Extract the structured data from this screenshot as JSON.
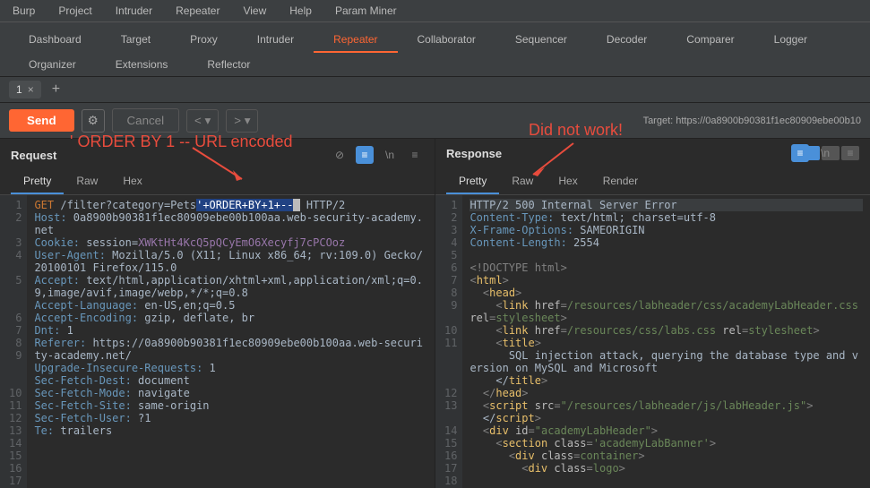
{
  "menu": [
    "Burp",
    "Project",
    "Intruder",
    "Repeater",
    "View",
    "Help",
    "Param Miner"
  ],
  "mainTabs": [
    "Dashboard",
    "Target",
    "Proxy",
    "Intruder",
    "Repeater",
    "Collaborator",
    "Sequencer",
    "Decoder",
    "Comparer",
    "Logger",
    "Organizer",
    "Extensions",
    "Reflector"
  ],
  "activeMainTab": "Repeater",
  "repeaterTab": {
    "label": "1"
  },
  "toolbar": {
    "send": "Send",
    "cancel": "Cancel"
  },
  "target": "Target: https://0a8900b90381f1ec80909ebe00b10",
  "request": {
    "title": "Request",
    "tabs": [
      "Pretty",
      "Raw",
      "Hex"
    ],
    "lines": [
      1,
      2,
      3,
      4,
      5,
      6,
      7,
      8,
      9,
      10,
      11,
      12,
      13,
      14,
      15,
      16,
      17
    ]
  },
  "requestText": {
    "l1a": "GET",
    "l1b": " /filter?category=Pets",
    "l1sel": "'+ORDER+BY+1+--",
    "l1c": " HTTP/2",
    "l2a": "Host:",
    "l2b": " 0a8900b90381f1ec80909ebe00b100aa.web-security-academy.net",
    "l3a": "Cookie:",
    "l3b": " session=",
    "l3c": "XWKtHt4KcQ5pQCyEmO6Xecyfj7cPCOoz",
    "l4a": "User-Agent:",
    "l4b": " Mozilla/5.0 (X11; Linux x86_64; rv:109.0) Gecko/20100101 Firefox/115.0",
    "l5a": "Accept:",
    "l5b": " text/html,application/xhtml+xml,application/xml;q=0.9,image/avif,image/webp,*/*;q=0.8",
    "l6a": "Accept-Language:",
    "l6b": " en-US,en;q=0.5",
    "l7a": "Accept-Encoding:",
    "l7b": " gzip, deflate, br",
    "l8a": "Dnt:",
    "l8b": " 1",
    "l9a": "Referer:",
    "l9b": " https://0a8900b90381f1ec80909ebe00b100aa.web-security-academy.net/",
    "l10a": "Upgrade-Insecure-Requests:",
    "l10b": " 1",
    "l11a": "Sec-Fetch-Dest:",
    "l11b": " document",
    "l12a": "Sec-Fetch-Mode:",
    "l12b": " navigate",
    "l13a": "Sec-Fetch-Site:",
    "l13b": " same-origin",
    "l14a": "Sec-Fetch-User:",
    "l14b": " ?1",
    "l15a": "Te:",
    "l15b": " trailers"
  },
  "response": {
    "title": "Response",
    "tabs": [
      "Pretty",
      "Raw",
      "Hex",
      "Render"
    ],
    "lines": [
      1,
      2,
      3,
      4,
      5,
      6,
      7,
      8,
      9,
      10,
      11,
      12,
      13,
      14,
      15,
      16,
      17,
      18
    ]
  },
  "responseText": {
    "l1": "HTTP/2 500 Internal Server Error",
    "l2a": "Content-Type:",
    "l2b": " text/html; charset=utf-8",
    "l3a": "X-Frame-Options:",
    "l3b": " SAMEORIGIN",
    "l4a": "Content-Length:",
    "l4b": " 2554",
    "l6": "<!DOCTYPE html>",
    "l7o": "<",
    "l7t": "html",
    "l7c": ">",
    "l8i": "  ",
    "l8o": "<",
    "l8t": "head",
    "l8c": ">",
    "l9i": "    ",
    "l9o": "<",
    "l9t": "link",
    "l9sp": " ",
    "l9a1": "href",
    "l9eq": "=",
    "l9v1": "/resources/labheader/css/academyLabHeader.css",
    "l9a2": "rel",
    "l9v2": "stylesheet",
    "l9c": ">",
    "l10i": "    ",
    "l10o": "<",
    "l10t": "link",
    "l10a1": "href",
    "l10v1": "/resources/css/labs.css",
    "l10a2": "rel",
    "l10v2": "stylesheet",
    "l10c": ">",
    "l11i": "    ",
    "l11o": "<",
    "l11t": "title",
    "l11c": ">",
    "l11txt": "      SQL injection attack, querying the database type and version on MySQL and Microsoft",
    "l11e": "    </",
    "l11et": "title",
    "l11ec": ">",
    "l12i": "  ",
    "l12o": "</",
    "l12t": "head",
    "l12c": ">",
    "l13i": "  ",
    "l13o": "<",
    "l13t": "script",
    "l13a1": "src",
    "l13v1": "\"/resources/labheader/js/labHeader.js\"",
    "l13c": ">",
    "l13e": "  </",
    "l13et": "script",
    "l13ec": ">",
    "l14i": "  ",
    "l14o": "<",
    "l14t": "div",
    "l14a1": "id",
    "l14v1": "\"academyLabHeader\"",
    "l14c": ">",
    "l15i": "    ",
    "l15o": "<",
    "l15t": "section",
    "l15a1": "class",
    "l15v1": "'academyLabBanner'",
    "l15c": ">",
    "l16i": "      ",
    "l16o": "<",
    "l16t": "div",
    "l16a1": "class",
    "l16v1": "container",
    "l16c": ">",
    "l17i": "        ",
    "l17o": "<",
    "l17t": "div",
    "l17a1": "class",
    "l17v1": "logo",
    "l17c": ">"
  },
  "annotations": {
    "a1": "' ORDER BY 1 -- URL encoded",
    "a2": "Did not work!"
  }
}
